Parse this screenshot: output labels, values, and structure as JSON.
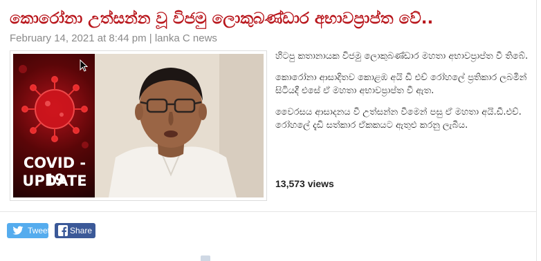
{
  "article": {
    "title": "කොරෝනා උත්සන්න වූ විජමු ලොකුබණ්ඩාර අභාවප්‍රාප්ත වේ..",
    "meta": "February 14, 2021 at 8:44 pm | lanka C news",
    "paragraphs": [
      "හිටපු කතානායක විජමු ලොකුබණ්ඩාර මහතා අභාවප්‍රාප්ත වී තිබේ.",
      "කොරෝනා ආසාදිතව කොළඹ අයි ඩී එච් රෝහලේ ප්‍රතිකාර ලබමින් සිටියදී එසේ ඒ මහතා අභාවප්‍රාප්ත වී ඇත.",
      "වෛරසය ආසාදනය වී උත්සන්න වීමෙන් පසු ඒ මහතා අයි.ඩී.එච්. රෝහලේ දැඩි සත්කාර ඒකකයට ඇතුළු කරනු ලැබීය."
    ],
    "views": "13,573 views"
  },
  "image": {
    "badge_line1": "COVID - 19",
    "badge_line2": "UPDATE"
  },
  "share": {
    "tweet_label": "Tweet",
    "share_label": "Share"
  },
  "colors": {
    "title": "#b8151b",
    "twitter": "#55acee",
    "facebook": "#3b5998"
  }
}
